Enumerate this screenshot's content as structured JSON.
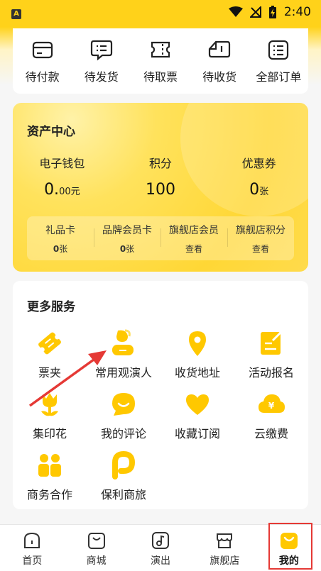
{
  "status_bar": {
    "app_badge": "A",
    "time": "2:40",
    "icons": [
      "wifi-icon",
      "no-signal-icon",
      "battery-charging-icon"
    ]
  },
  "orders": {
    "items": [
      {
        "label": "待付款",
        "icon": "card-icon"
      },
      {
        "label": "待发货",
        "icon": "chat-box-icon"
      },
      {
        "label": "待取票",
        "icon": "ticket-icon"
      },
      {
        "label": "待收货",
        "icon": "truck-icon"
      },
      {
        "label": "全部订单",
        "icon": "list-icon"
      }
    ]
  },
  "assets": {
    "title": "资产中心",
    "wallet": {
      "label": "电子钱包",
      "value": "0.",
      "value_small": "00元"
    },
    "points": {
      "label": "积分",
      "value": "100"
    },
    "coupons": {
      "label": "优惠券",
      "value": "0",
      "unit": "张"
    },
    "sub": [
      {
        "label": "礼品卡",
        "value": "0",
        "unit": "张"
      },
      {
        "label": "品牌会员卡",
        "value": "0",
        "unit": "张"
      },
      {
        "label": "旗舰店会员",
        "value": "查看"
      },
      {
        "label": "旗舰店积分",
        "value": "查看"
      }
    ]
  },
  "services": {
    "title": "更多服务",
    "items": [
      {
        "label": "票夹",
        "icon": "ticket-folder-icon"
      },
      {
        "label": "常用观演人",
        "icon": "audience-person-icon"
      },
      {
        "label": "收货地址",
        "icon": "location-pin-icon"
      },
      {
        "label": "活动报名",
        "icon": "signup-form-icon"
      },
      {
        "label": "集印花",
        "icon": "flower-stamp-icon"
      },
      {
        "label": "我的评论",
        "icon": "comment-smile-icon"
      },
      {
        "label": "收藏订阅",
        "icon": "heart-icon"
      },
      {
        "label": "云缴费",
        "icon": "cloud-yuan-icon"
      },
      {
        "label": "商务合作",
        "icon": "partners-icon"
      },
      {
        "label": "保利商旅",
        "icon": "travel-p-icon"
      }
    ]
  },
  "bottom_nav": {
    "items": [
      {
        "label": "首页",
        "icon": "home-icon"
      },
      {
        "label": "商城",
        "icon": "shopping-bag-icon"
      },
      {
        "label": "演出",
        "icon": "music-note-icon"
      },
      {
        "label": "旗舰店",
        "icon": "store-icon"
      },
      {
        "label": "我的",
        "icon": "profile-smile-icon",
        "active": true
      }
    ]
  },
  "colors": {
    "brand_yellow": "#ffd21a",
    "icon_yellow": "#ffc800",
    "annotation_red": "#e53935"
  }
}
